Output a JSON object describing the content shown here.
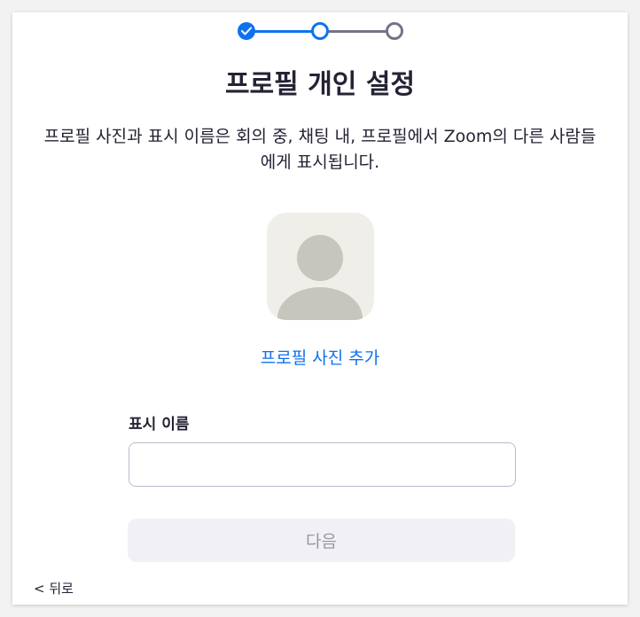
{
  "stepper": {
    "completed_color": "#0e72ed",
    "pending_color": "#747487",
    "steps": [
      "completed",
      "current",
      "pending"
    ]
  },
  "page": {
    "title": "프로필 개인 설정",
    "description": "프로필 사진과 표시 이름은 회의 중, 채팅 내, 프로필에서 Zoom의 다른 사람들에게 표시됩니다."
  },
  "avatar": {
    "icon": "default-user-avatar-icon",
    "add_photo_label": "프로필 사진 추가"
  },
  "form": {
    "display_name_label": "표시 이름",
    "display_name_value": "",
    "display_name_placeholder": ""
  },
  "actions": {
    "next_label": "다음",
    "back_label": "< 뒤로"
  }
}
